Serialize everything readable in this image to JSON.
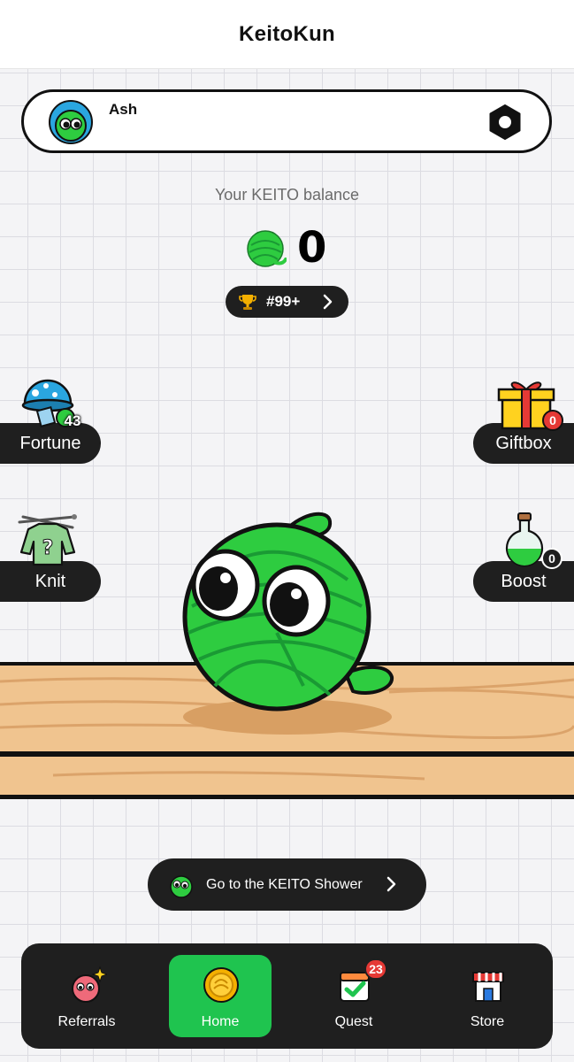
{
  "app": {
    "title": "KeitoKun"
  },
  "profile": {
    "username": "Ash"
  },
  "balance": {
    "label": "Your KEITO balance",
    "value": "0"
  },
  "rank": {
    "text": "#99+"
  },
  "side": {
    "fortune": {
      "label": "Fortune",
      "badge": "43"
    },
    "giftbox": {
      "label": "Giftbox",
      "badge": "0"
    },
    "knit": {
      "label": "Knit"
    },
    "boost": {
      "label": "Boost",
      "badge": "0"
    }
  },
  "shower": {
    "label": "Go to the KEITO Shower"
  },
  "nav": [
    {
      "label": "Referrals",
      "icon": "referrals-icon"
    },
    {
      "label": "Home",
      "icon": "coin-icon",
      "active": true
    },
    {
      "label": "Quest",
      "icon": "quest-calendar-icon",
      "badge": "23"
    },
    {
      "label": "Store",
      "icon": "store-icon"
    }
  ],
  "colors": {
    "accent_green": "#1fc44f",
    "dark_pill": "#1f1f1f",
    "yarn_green": "#2ecc40",
    "wood": "#f0c48f",
    "badge_red": "#e53935"
  }
}
